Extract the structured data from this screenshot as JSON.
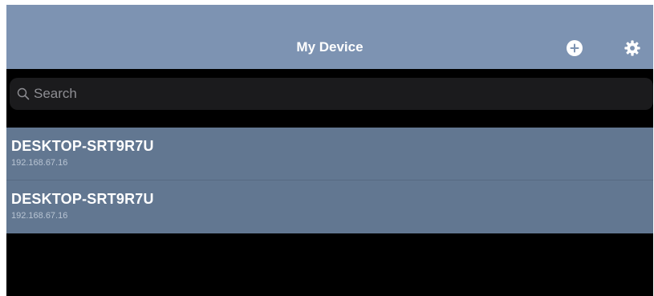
{
  "header": {
    "title": "My Device",
    "add_icon": "plus-circle-icon",
    "settings_icon": "gear-icon",
    "bar_color": "#7d93b2"
  },
  "search": {
    "placeholder": "Search",
    "value": "",
    "icon": "search-icon"
  },
  "devices": [
    {
      "name": "DESKTOP-SRT9R7U",
      "ip": "192.168.67.16"
    },
    {
      "name": "DESKTOP-SRT9R7U",
      "ip": "192.168.67.16"
    }
  ],
  "colors": {
    "list_background": "#627791",
    "background": "#000000"
  }
}
